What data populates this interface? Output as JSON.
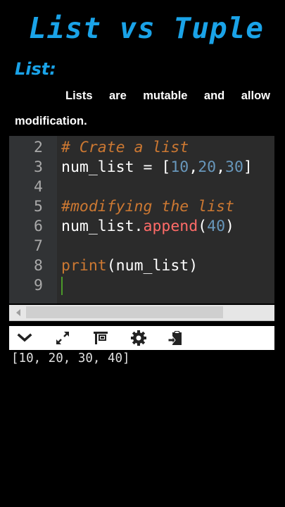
{
  "header": {
    "title": "List vs Tuple",
    "subheading": "List:",
    "description_words": [
      "Lists",
      "are",
      "mutable",
      "and",
      "allow"
    ],
    "description_line2": "modification."
  },
  "editor": {
    "lines": [
      {
        "number": "2",
        "segments": [
          {
            "text": "# Crate a list",
            "type": "comment"
          }
        ]
      },
      {
        "number": "3",
        "segments": [
          {
            "text": "num_list = [",
            "type": "default"
          },
          {
            "text": "10",
            "type": "num"
          },
          {
            "text": ",",
            "type": "default"
          },
          {
            "text": "20",
            "type": "num"
          },
          {
            "text": ",",
            "type": "default"
          },
          {
            "text": "30",
            "type": "num"
          },
          {
            "text": "]",
            "type": "default"
          }
        ]
      },
      {
        "number": "4",
        "segments": []
      },
      {
        "number": "5",
        "segments": [
          {
            "text": "#modifying the list",
            "type": "comment"
          }
        ]
      },
      {
        "number": "6",
        "segments": [
          {
            "text": "num_list.",
            "type": "default"
          },
          {
            "text": "append",
            "type": "method"
          },
          {
            "text": "(",
            "type": "default"
          },
          {
            "text": "40",
            "type": "num"
          },
          {
            "text": ")",
            "type": "default"
          }
        ]
      },
      {
        "number": "7",
        "segments": []
      },
      {
        "number": "8",
        "segments": [
          {
            "text": "print",
            "type": "fn"
          },
          {
            "text": "(num_list)",
            "type": "default"
          }
        ]
      },
      {
        "number": "9",
        "segments": [],
        "cursor": true
      }
    ]
  },
  "toolbar": {
    "icons": [
      "chevron-down-icon",
      "expand-icon",
      "layout-icon",
      "gear-icon",
      "clipboard-icon"
    ]
  },
  "output": {
    "text": "[10, 20, 30, 40]"
  },
  "colors": {
    "accent": "#1aa3e8",
    "comment": "#cc7832",
    "number": "#6897bb",
    "method": "#ff6b68",
    "editor_bg": "#2b2b2b"
  }
}
